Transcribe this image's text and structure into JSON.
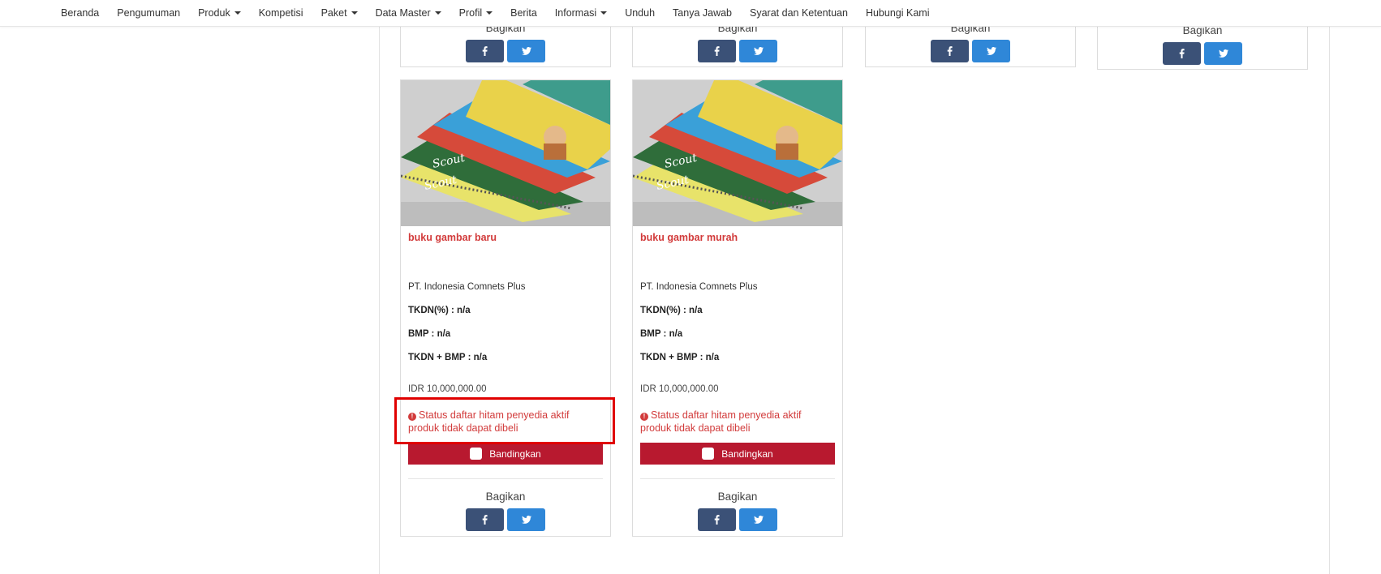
{
  "nav": {
    "items": [
      {
        "label": "Beranda",
        "dropdown": false
      },
      {
        "label": "Pengumuman",
        "dropdown": false
      },
      {
        "label": "Produk",
        "dropdown": true
      },
      {
        "label": "Kompetisi",
        "dropdown": false
      },
      {
        "label": "Paket",
        "dropdown": true
      },
      {
        "label": "Data Master",
        "dropdown": true
      },
      {
        "label": "Profil",
        "dropdown": true
      },
      {
        "label": "Berita",
        "dropdown": false
      },
      {
        "label": "Informasi",
        "dropdown": true
      },
      {
        "label": "Unduh",
        "dropdown": false
      },
      {
        "label": "Tanya Jawab",
        "dropdown": false
      },
      {
        "label": "Syarat dan Ketentuan",
        "dropdown": false
      },
      {
        "label": "Hubungi Kami",
        "dropdown": false
      }
    ]
  },
  "share_label": "Bagikan",
  "products": [
    {
      "title": "buku gambar baru",
      "vendor": "PT. Indonesia Comnets Plus",
      "tkdn": "TKDN(%) : n/a",
      "bmp": "BMP : n/a",
      "tkdn_bmp": "TKDN + BMP : n/a",
      "price": "IDR 10,000,000.00",
      "status": "Status daftar hitam penyedia aktif produk tidak dapat dibeli",
      "compare_label": "Bandingkan"
    },
    {
      "title": "buku gambar murah",
      "vendor": "PT. Indonesia Comnets Plus",
      "tkdn": "TKDN(%) : n/a",
      "bmp": "BMP : n/a",
      "tkdn_bmp": "TKDN + BMP : n/a",
      "price": "IDR 10,000,000.00",
      "status": "Status daftar hitam penyedia aktif produk tidak dapat dibeli",
      "compare_label": "Bandingkan"
    }
  ],
  "colors": {
    "facebook": "#3b5177",
    "twitter": "#2f87d8",
    "compare": "#b8192f",
    "alert": "#d23b3b",
    "highlight": "#e00000"
  }
}
